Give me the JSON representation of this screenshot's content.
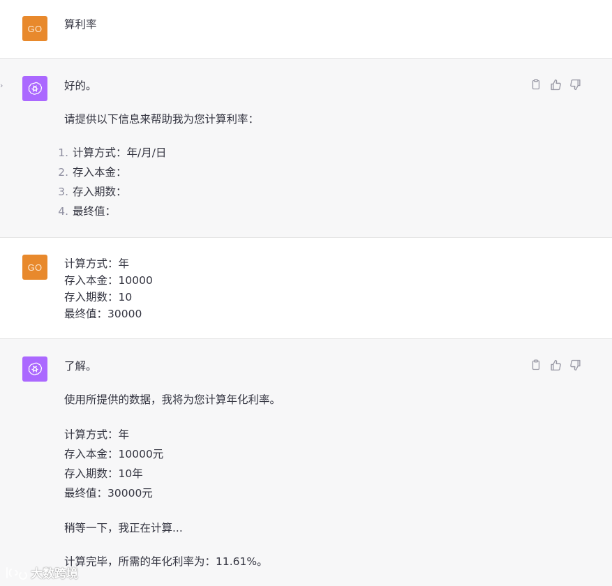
{
  "messages": [
    {
      "role": "user",
      "avatar": "GO",
      "lines": [
        "算利率"
      ]
    },
    {
      "role": "assistant",
      "intro": "好的。",
      "body": "请提供以下信息来帮助我为您计算利率：",
      "list": [
        {
          "num": "1.",
          "text": "计算方式：年/月/日"
        },
        {
          "num": "2.",
          "text": "存入本金："
        },
        {
          "num": "3.",
          "text": "存入期数："
        },
        {
          "num": "4.",
          "text": "最终值："
        }
      ],
      "actions": [
        "copy-icon",
        "thumbs-up-icon",
        "thumbs-down-icon"
      ]
    },
    {
      "role": "user",
      "avatar": "GO",
      "lines": [
        "计算方式：年",
        "存入本金：10000",
        "存入期数：10",
        "最终值：30000"
      ]
    },
    {
      "role": "assistant",
      "intro": "了解。",
      "body": "使用所提供的数据，我将为您计算年化利率。",
      "details": [
        "计算方式：年",
        "存入本金：10000元",
        "存入期数：10年",
        "最终值：30000元"
      ],
      "waiting": "稍等一下，我正在计算...",
      "result": "计算完毕，所需的年化利率为：11.61%。",
      "actions": [
        "copy-icon",
        "thumbs-up-icon",
        "thumbs-down-icon"
      ]
    }
  ],
  "sidebar_chevron": "›",
  "watermark": "大数跨境",
  "colors": {
    "user_avatar_bg": "#e8892c",
    "bot_avatar_bg": "#ab68ff",
    "bot_message_bg": "#f7f7f8",
    "text": "#343541"
  }
}
